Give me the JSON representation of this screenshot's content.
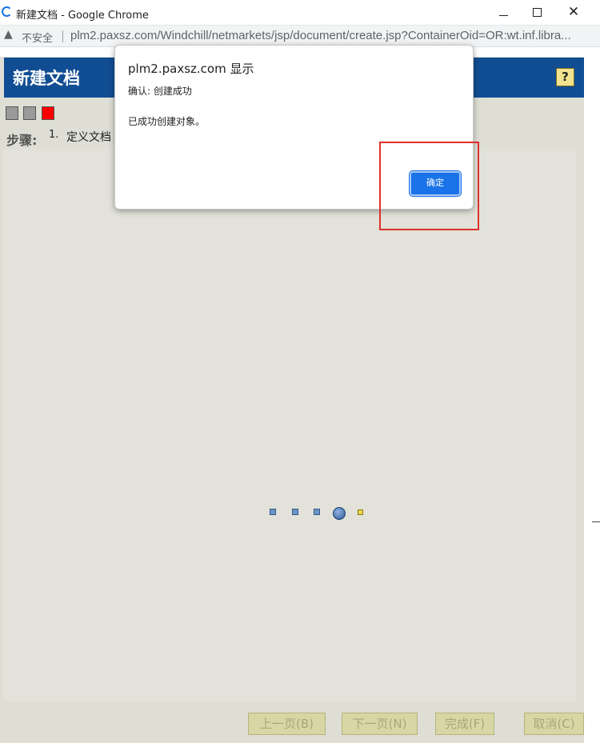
{
  "window": {
    "title": "新建文档 - Google Chrome",
    "minimize_icon": "minimize-icon",
    "maximize_icon": "maximize-icon",
    "close_glyph": "✕"
  },
  "address_bar": {
    "security_label": "不安全",
    "url": "plm2.paxsz.com/Windchill/netmarkets/jsp/document/create.jsp?ContainerOid=OR:wt.inf.libra..."
  },
  "page": {
    "title": "新建文档",
    "help_label": "?",
    "steps_label": "步骤:",
    "step_number": "1.",
    "step_name": "定义文档"
  },
  "buttons": {
    "prev": "上一页(B)",
    "next": "下一页(N)",
    "finish": "完成(F)",
    "cancel": "取消(C)"
  },
  "dialog": {
    "title": "plm2.paxsz.com 显示",
    "line1": "确认: 创建成功",
    "line2": "已成功创建对象。",
    "ok_label": "确定"
  },
  "colors": {
    "header_bg": "#114d93",
    "dialog_button": "#1a73e8",
    "highlight_border": "#e0302a",
    "step_square_active": "#ff0000"
  }
}
